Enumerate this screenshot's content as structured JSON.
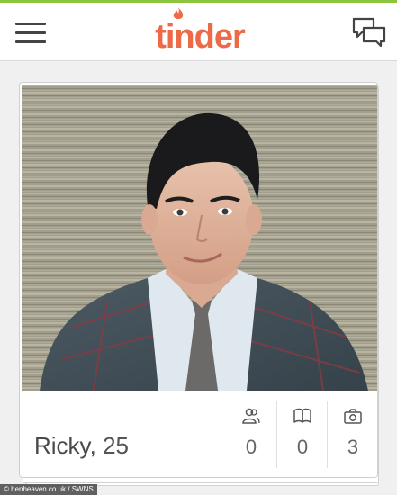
{
  "app": {
    "logo_text": "tinder",
    "accent": "#ec6a47"
  },
  "header": {
    "menu_icon": "hamburger-menu-icon",
    "chat_icon": "chat-bubbles-icon"
  },
  "profile": {
    "name": "Ricky",
    "separator": ",",
    "age": "25",
    "stats": [
      {
        "icon": "friends-icon",
        "value": "0"
      },
      {
        "icon": "interests-book-icon",
        "value": "0"
      },
      {
        "icon": "camera-photos-icon",
        "value": "3"
      }
    ]
  },
  "caption": "© henheaven.co.uk / SWNS"
}
